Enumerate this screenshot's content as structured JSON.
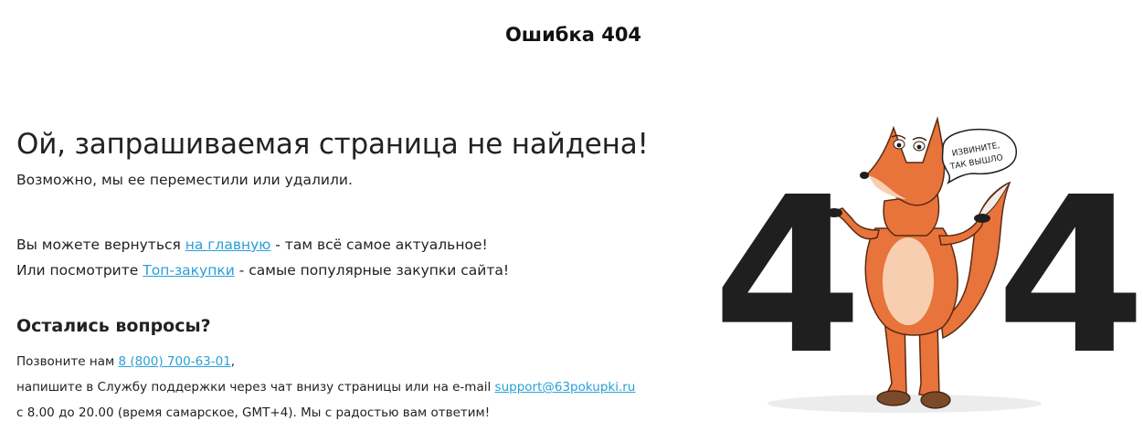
{
  "header": {
    "title": "Ошибка 404"
  },
  "main": {
    "headline": "Ой, запрашиваемая страница не найдена!",
    "subline": "Возможно, мы ее переместили или удалили.",
    "line1_before": "Вы можете вернуться ",
    "line1_link": "на главную",
    "line1_after": " - там всё самое актуальное!",
    "line2_before": "Или посмотрите ",
    "line2_link": "Топ-закупки",
    "line2_after": " - самые популярные закупки сайта!"
  },
  "contact": {
    "title": "Остались вопросы?",
    "line1_before": "Позвоните нам ",
    "phone": "8 (800) 700-63-01",
    "line1_after": ",",
    "line2_before": "напишите в Службу поддержки через чат внизу страницы или на e-mail ",
    "email": "support@63pokupki.ru",
    "line3": "с 8.00 до 20.00 (время самарское, GMT+4). Мы с радостью вам ответим!"
  },
  "illustration": {
    "digit_left": "4",
    "digit_right": "4",
    "speech_line1": "ИЗВИНИТЕ,",
    "speech_line2": "ТАК ВЫШЛО",
    "colors": {
      "fox": "#e8743b",
      "belly": "#f7cfb0",
      "digits": "#1f1f1f"
    }
  }
}
